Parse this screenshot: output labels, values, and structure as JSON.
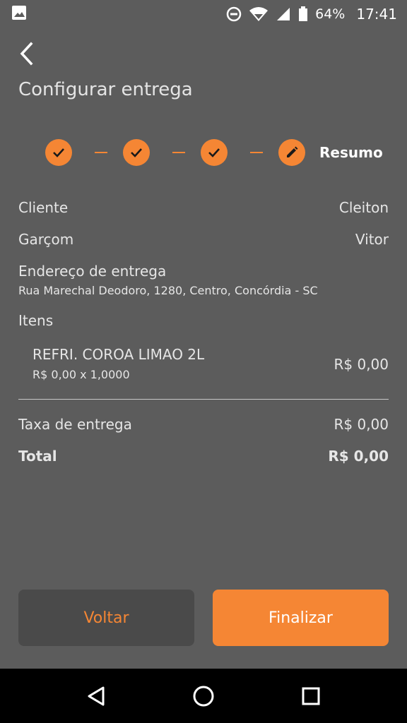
{
  "status_bar": {
    "battery": "64%",
    "time": "17:41",
    "icons": [
      "image-icon",
      "do-not-disturb-icon",
      "wifi-icon",
      "signal-icon",
      "battery-icon"
    ]
  },
  "header": {
    "title": "Configurar entrega",
    "back_icon": "chevron-left-icon"
  },
  "stepper": {
    "steps": [
      {
        "status": "done",
        "icon": "check-icon"
      },
      {
        "status": "done",
        "icon": "check-icon"
      },
      {
        "status": "done",
        "icon": "check-icon"
      },
      {
        "status": "current",
        "icon": "pencil-icon"
      }
    ],
    "current_label": "Resumo"
  },
  "summary": {
    "client_label": "Cliente",
    "client_value": "Cleiton",
    "waiter_label": "Garçom",
    "waiter_value": "Vitor",
    "address_label": "Endereço de entrega",
    "address_value": "Rua Marechal Deodoro, 1280, Centro, Concórdia - SC",
    "items_label": "Itens",
    "items": [
      {
        "name": "REFRI. COROA LIMAO 2L",
        "qty": "R$ 0,00 x 1,0000",
        "price": "R$ 0,00"
      }
    ],
    "fee_label": "Taxa de entrega",
    "fee_value": "R$ 0,00",
    "total_label": "Total",
    "total_value": "R$ 0,00"
  },
  "actions": {
    "back_label": "Voltar",
    "finish_label": "Finalizar"
  },
  "colors": {
    "accent": "#f58634",
    "background": "#5c5c5c",
    "secondary_button": "#4a4a4a"
  },
  "nav_bar": {
    "icons": [
      "back-triangle-icon",
      "home-circle-icon",
      "recents-square-icon"
    ]
  }
}
